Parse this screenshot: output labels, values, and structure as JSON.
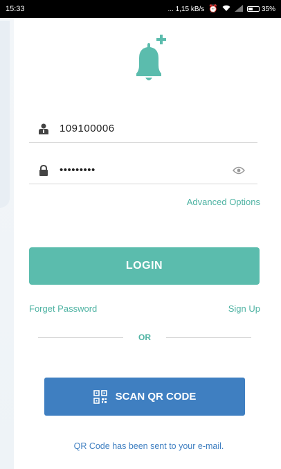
{
  "status_bar": {
    "time": "15:33",
    "network_speed": "... 1,15 kB/s",
    "battery_percent": "35%",
    "icons": [
      "alarm-icon",
      "wifi-icon",
      "signal-icon",
      "battery-icon"
    ]
  },
  "logo": {
    "icon": "bell-plus-icon"
  },
  "login_form": {
    "username_value": "109100006",
    "password_mask": "•••••••••",
    "user_icon": "user-icon",
    "lock_icon": "lock-icon",
    "eye_icon": "eye-icon"
  },
  "advanced_options_label": "Advanced Options",
  "login_button_label": "LOGIN",
  "forget_password_label": "Forget Password",
  "sign_up_label": "Sign Up",
  "or_label": "OR",
  "scan_button": {
    "label": "SCAN QR CODE",
    "icon": "qr-code-icon"
  },
  "info_message": "QR Code has been sent to your e-mail.",
  "colors": {
    "accent": "#5bbcad",
    "accent_text": "#4fb3a3",
    "scan_button": "#3f7fc1"
  }
}
